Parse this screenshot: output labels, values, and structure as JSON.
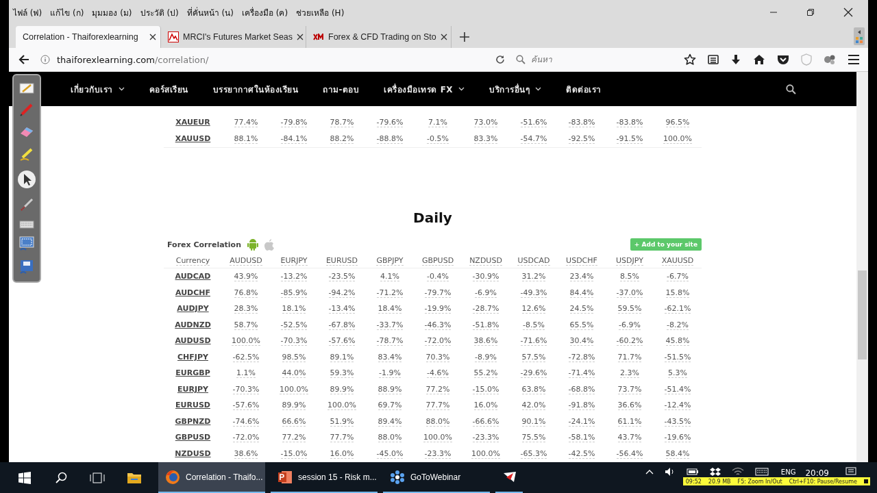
{
  "menu_bar": [
    "ไฟล์ (ฟ)",
    "แก้ไข (ก)",
    "มุมมอง (ม)",
    "ประวัติ (ป)",
    "ที่คั่นหน้า (น)",
    "เครื่องมือ (ค)",
    "ช่วยเหลือ (H)"
  ],
  "tabs": [
    {
      "title": "Correlation - Thaiforexlearning",
      "selected": true,
      "kind": "globe"
    },
    {
      "title": "MRCI's Futures Market Seas",
      "selected": false,
      "kind": "mrci"
    },
    {
      "title": "Forex & CFD Trading on Sto",
      "selected": false,
      "kind": "xm"
    }
  ],
  "address_bar": {
    "domain": "thaiforexlearning.com",
    "path": "/correlation/"
  },
  "search": {
    "placeholder": "ค้นหา"
  },
  "nav": [
    {
      "label": "เกี่ยวกับเรา",
      "has_dropdown": true
    },
    {
      "label": "คอร์สเรียน",
      "has_dropdown": false
    },
    {
      "label": "บรรยากาศในห้องเรียน",
      "has_dropdown": false
    },
    {
      "label": "ถาม-ตอบ",
      "has_dropdown": false
    },
    {
      "label": "เครื่องมือเทรด FX",
      "has_dropdown": true
    },
    {
      "label": "บริการอื่นๆ",
      "has_dropdown": true
    },
    {
      "label": "ติดต่อเรา",
      "has_dropdown": false
    }
  ],
  "upper_table": {
    "rows": [
      {
        "pair": "XAUEUR",
        "values": [
          "77.4%",
          "-79.8%",
          "78.7%",
          "-79.6%",
          "7.1%",
          "73.0%",
          "-51.6%",
          "-83.8%",
          "-83.8%",
          "96.5%"
        ]
      },
      {
        "pair": "XAUUSD",
        "values": [
          "88.1%",
          "-84.1%",
          "88.2%",
          "-88.8%",
          "-0.5%",
          "83.3%",
          "-54.7%",
          "-92.5%",
          "-91.5%",
          "100.0%"
        ]
      }
    ]
  },
  "daily": {
    "title": "Daily",
    "widget_title": "Forex Correlation",
    "add_button": "+ Add to your site",
    "columns": [
      "Currency",
      "AUDUSD",
      "EURJPY",
      "EURUSD",
      "GBPJPY",
      "GBPUSD",
      "NZDUSD",
      "USDCAD",
      "USDCHF",
      "USDJPY",
      "XAUUSD"
    ],
    "rows": [
      {
        "pair": "AUDCAD",
        "values": [
          "43.9%",
          "-13.2%",
          "-23.5%",
          "4.1%",
          "-0.4%",
          "-30.9%",
          "31.2%",
          "23.4%",
          "8.5%",
          "-6.7%"
        ]
      },
      {
        "pair": "AUDCHF",
        "values": [
          "76.8%",
          "-85.9%",
          "-94.2%",
          "-71.2%",
          "-79.7%",
          "-6.9%",
          "-49.3%",
          "84.4%",
          "-37.0%",
          "15.8%"
        ]
      },
      {
        "pair": "AUDJPY",
        "values": [
          "28.3%",
          "18.1%",
          "-13.4%",
          "18.4%",
          "-19.9%",
          "-28.7%",
          "12.6%",
          "24.5%",
          "59.5%",
          "-62.1%"
        ]
      },
      {
        "pair": "AUDNZD",
        "values": [
          "58.7%",
          "-52.5%",
          "-67.8%",
          "-33.7%",
          "-46.3%",
          "-51.8%",
          "-8.5%",
          "65.5%",
          "-6.9%",
          "-8.2%"
        ]
      },
      {
        "pair": "AUDUSD",
        "values": [
          "100.0%",
          "-70.3%",
          "-57.6%",
          "-78.7%",
          "-72.0%",
          "38.6%",
          "-71.6%",
          "30.4%",
          "-60.2%",
          "45.8%"
        ]
      },
      {
        "pair": "CHFJPY",
        "values": [
          "-62.5%",
          "98.5%",
          "89.1%",
          "83.4%",
          "70.3%",
          "-8.9%",
          "57.5%",
          "-72.8%",
          "71.7%",
          "-51.5%"
        ]
      },
      {
        "pair": "EURGBP",
        "values": [
          "1.1%",
          "44.0%",
          "59.3%",
          "-1.9%",
          "-4.6%",
          "55.2%",
          "-29.6%",
          "-71.4%",
          "2.3%",
          "5.3%"
        ]
      },
      {
        "pair": "EURJPY",
        "values": [
          "-70.3%",
          "100.0%",
          "89.9%",
          "88.9%",
          "77.2%",
          "-15.0%",
          "63.8%",
          "-68.8%",
          "73.7%",
          "-51.4%"
        ]
      },
      {
        "pair": "EURUSD",
        "values": [
          "-57.6%",
          "89.9%",
          "100.0%",
          "69.7%",
          "77.7%",
          "16.0%",
          "42.0%",
          "-91.8%",
          "36.6%",
          "-12.4%"
        ]
      },
      {
        "pair": "GBPNZD",
        "values": [
          "-74.6%",
          "66.6%",
          "51.9%",
          "89.4%",
          "88.0%",
          "-66.6%",
          "90.1%",
          "-24.1%",
          "61.1%",
          "-43.5%"
        ]
      },
      {
        "pair": "GBPUSD",
        "values": [
          "-72.0%",
          "77.2%",
          "77.7%",
          "88.0%",
          "100.0%",
          "-23.3%",
          "75.5%",
          "-58.1%",
          "43.7%",
          "-19.6%"
        ]
      },
      {
        "pair": "NZDUSD",
        "values": [
          "38.6%",
          "-15.0%",
          "16.0%",
          "-45.0%",
          "-23.3%",
          "100.0%",
          "-65.3%",
          "-42.5%",
          "-56.4%",
          "58.4%"
        ]
      }
    ]
  },
  "taskbar": {
    "apps": [
      {
        "label": "Correlation - Thaifo...",
        "selected": true,
        "kind": "firefox"
      },
      {
        "label": "session 15 - Risk m...",
        "selected": false,
        "kind": "powerpoint"
      },
      {
        "label": "GoToWebinar",
        "selected": false,
        "kind": "webinar"
      }
    ],
    "language": "ENG",
    "time": "20:09"
  },
  "recorder_bar": [
    "09:52",
    "20.9 MB",
    "F5: Zoom In/Out",
    "Ctrl+F10: Pause/Resume"
  ]
}
